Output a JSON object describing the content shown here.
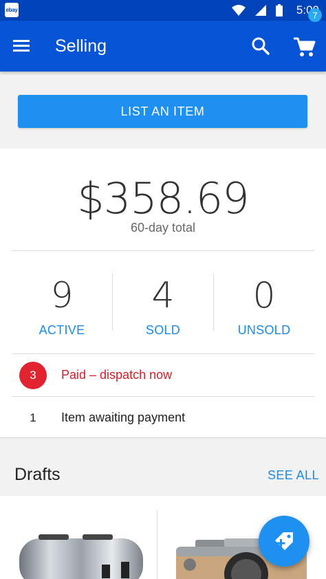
{
  "status_bar": {
    "app_icon_label": "ebay",
    "time": "5:00"
  },
  "app_bar": {
    "title": "Selling",
    "cart_count": "7"
  },
  "list_button_label": "LIST AN ITEM",
  "summary": {
    "total": "$358.69",
    "total_label": "60-day total",
    "stats": [
      {
        "value": "9",
        "label": "ACTIVE"
      },
      {
        "value": "4",
        "label": "SOLD"
      },
      {
        "value": "0",
        "label": "UNSOLD"
      }
    ],
    "tasks": [
      {
        "count": "3",
        "label": "Paid – dispatch now"
      },
      {
        "count": "1",
        "label": "Item awaiting payment"
      }
    ]
  },
  "drafts": {
    "title": "Drafts",
    "see_all": "SEE ALL"
  },
  "colors": {
    "app_bar": "#0654d6",
    "status_bar": "#0042b8",
    "accent": "#1e90f0",
    "alert": "#e0232f"
  }
}
